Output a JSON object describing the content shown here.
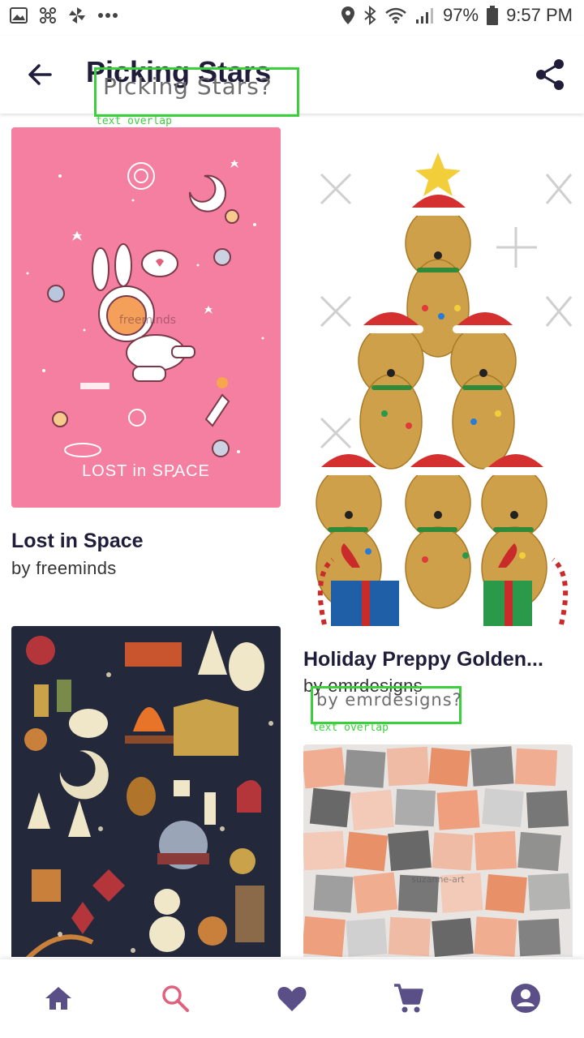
{
  "status_bar": {
    "battery": "97%",
    "time": "9:57 PM",
    "icons": [
      "image-icon",
      "pinwheel-icon",
      "fan-icon",
      "more-icon",
      "location-icon",
      "bluetooth-icon",
      "wifi-icon",
      "signal-icon",
      "battery-icon"
    ]
  },
  "app_bar": {
    "title": "Picking Stars",
    "back_icon": "arrow-back-icon",
    "share_icon": "share-icon"
  },
  "overlays": [
    {
      "text": "Picking Stars?",
      "caption": "text overlap"
    },
    {
      "text": "by emrdesigns?",
      "caption": "text overlap"
    }
  ],
  "products": [
    {
      "title": "Lost in Space",
      "by": "by freeminds",
      "art_caption": "LOST in SPACE",
      "watermark": "freeminds",
      "bg": "#f47fa1"
    },
    {
      "title": "Holiday Preppy Golden...",
      "by": "by emrdesigns",
      "bg": "#ffffff"
    },
    {
      "title": "",
      "by": "",
      "bg": "#23283a"
    },
    {
      "title": "",
      "by": "",
      "watermark": "suzanne-art",
      "bg": "#e8e4e2"
    }
  ],
  "bottom_nav": [
    {
      "name": "home",
      "icon": "home-icon",
      "active": false
    },
    {
      "name": "search",
      "icon": "search-icon",
      "active": true
    },
    {
      "name": "favorites",
      "icon": "heart-icon",
      "active": false
    },
    {
      "name": "cart",
      "icon": "cart-icon",
      "active": false
    },
    {
      "name": "account",
      "icon": "account-icon",
      "active": false
    }
  ],
  "colors": {
    "nav_icon": "#5a4f86",
    "nav_active": "#e0607e",
    "title": "#1f1d3a",
    "overlay": "#3ccf3c"
  }
}
